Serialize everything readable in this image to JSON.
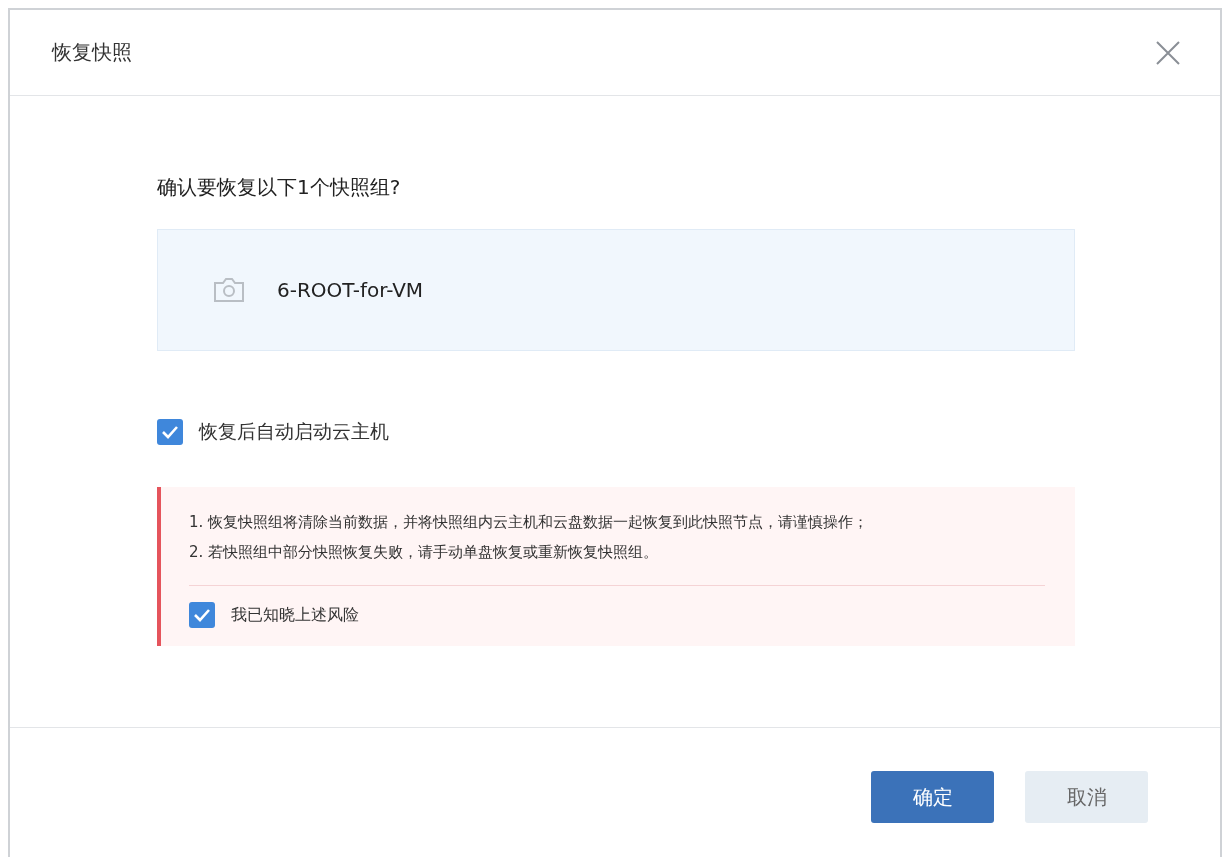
{
  "dialog": {
    "title": "恢复快照"
  },
  "question": "确认要恢复以下1个快照组?",
  "snapshots": [
    {
      "name": "6-ROOT-for-VM"
    }
  ],
  "auto_start": {
    "label": "恢复后自动启动云主机",
    "checked": true
  },
  "warning": {
    "lines": [
      "1. 恢复快照组将清除当前数据，并将快照组内云主机和云盘数据一起恢复到此快照节点，请谨慎操作；",
      "2. 若快照组中部分快照恢复失败，请手动单盘恢复或重新恢复快照组。"
    ],
    "acknowledge": {
      "label": "我已知晓上述风险",
      "checked": true
    }
  },
  "buttons": [
    {
      "label": "确定",
      "kind": "primary"
    },
    {
      "label": "取消",
      "kind": "secondary"
    }
  ]
}
